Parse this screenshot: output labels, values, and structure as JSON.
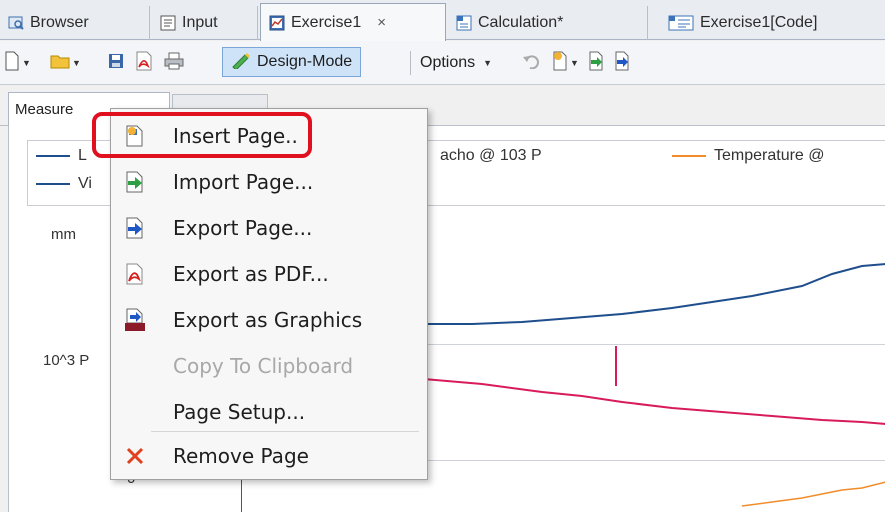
{
  "tabs": [
    {
      "label": "Browser",
      "icon": "browser-icon"
    },
    {
      "label": "Input",
      "icon": "input-icon"
    },
    {
      "label": "Exercise1",
      "icon": "curve-window-icon",
      "active": true,
      "close": "×"
    },
    {
      "label": "Calculation*",
      "icon": "sequence-icon"
    },
    {
      "label": "Exercise1[Code]",
      "icon": "code-icon"
    }
  ],
  "toolbar": {
    "design_mode_label": "Design-Mode",
    "options_label": "Options"
  },
  "subtab": {
    "label": "Measure"
  },
  "chart": {
    "legend": [
      {
        "label": "L",
        "color": "#1f4e8c"
      },
      {
        "label": "Vi",
        "color": "#1f4e8c"
      },
      {
        "label": "acho @ 103 P",
        "color": "#1f4e8c"
      },
      {
        "label": "Temperature @",
        "color": "#f08c2a"
      }
    ],
    "axis_labels": [
      "mm",
      "10^3 P",
      "0"
    ],
    "colors": {
      "blue": "#1f4e8c",
      "red": "#d81b5a",
      "orange": "#f08c2a"
    }
  },
  "context_menu": {
    "items": [
      {
        "label": "Insert Page..",
        "icon": "insert-page-icon",
        "enabled": true
      },
      {
        "label": "Import Page...",
        "icon": "import-page-icon",
        "enabled": true
      },
      {
        "label": "Export Page...",
        "icon": "export-page-icon",
        "enabled": true
      },
      {
        "label": "Export as PDF...",
        "icon": "pdf-icon",
        "enabled": true
      },
      {
        "label": "Export as Graphics",
        "icon": "imc-graphics-icon",
        "enabled": true
      },
      {
        "label": "Copy To Clipboard",
        "icon": "",
        "enabled": false
      },
      {
        "label": "Page Setup...",
        "icon": "",
        "enabled": true
      },
      {
        "label": "Remove Page",
        "icon": "remove-x-icon",
        "enabled": true
      }
    ]
  },
  "annotation": {
    "color": "#e0101e"
  }
}
